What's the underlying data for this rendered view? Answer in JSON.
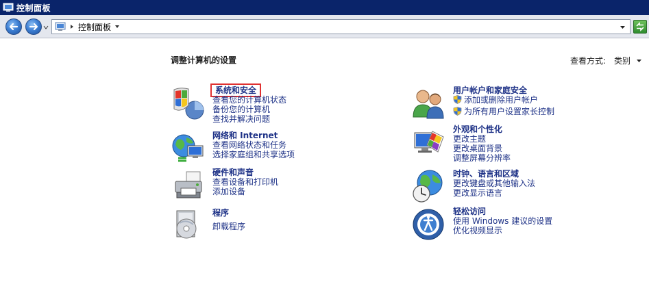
{
  "window": {
    "title": "控制面板"
  },
  "toolbar": {
    "address_text": "控制面板"
  },
  "main": {
    "page_title": "调整计算机的设置",
    "view_by_label": "查看方式:",
    "view_by_value": "类别",
    "categories": [
      {
        "title": "系统和安全",
        "icon": "shield-icon",
        "links": [
          "查看您的计算机状态",
          "备份您的计算机",
          "查找并解决问题"
        ]
      },
      {
        "title": "网络和 Internet",
        "icon": "network-globe-icon",
        "links": [
          "查看网络状态和任务",
          "选择家庭组和共享选项"
        ]
      },
      {
        "title": "硬件和声音",
        "icon": "printer-icon",
        "links": [
          "查看设备和打印机",
          "添加设备"
        ]
      },
      {
        "title": "程序",
        "icon": "programs-disc-icon",
        "links": [
          "卸载程序"
        ]
      },
      {
        "title": "用户帐户和家庭安全",
        "icon": "users-icon",
        "links": [
          "添加或删除用户帐户",
          "为所有用户设置家长控制"
        ]
      },
      {
        "title": "外观和个性化",
        "icon": "appearance-monitor-icon",
        "links": [
          "更改主题",
          "更改桌面背景",
          "调整屏幕分辨率"
        ]
      },
      {
        "title": "时钟、语言和区域",
        "icon": "clock-globe-icon",
        "links": [
          "更改键盘或其他输入法",
          "更改显示语言"
        ]
      },
      {
        "title": "轻松访问",
        "icon": "ease-of-access-icon",
        "links": [
          "使用 Windows 建议的设置",
          "优化视频显示"
        ]
      }
    ]
  },
  "colors": {
    "titlebar": "#0a246a",
    "link": "#1e3287",
    "focus_outline": "#e03131"
  }
}
